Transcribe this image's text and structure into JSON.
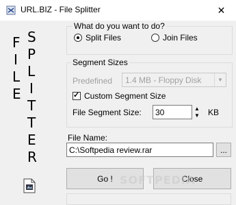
{
  "window": {
    "title": "URL.BIZ - File Splitter",
    "close_glyph": "✕"
  },
  "banner": {
    "word1": [
      "F",
      "I",
      "L",
      "E"
    ],
    "word2": [
      "S",
      "P",
      "L",
      "I",
      "T",
      "T",
      "E",
      "R"
    ]
  },
  "mode_group": {
    "title": "What do you want to do?",
    "options": [
      {
        "label": "Split Files",
        "selected": true
      },
      {
        "label": "Join Files",
        "selected": false
      }
    ]
  },
  "segment_group": {
    "title": "Segment Sizes",
    "predefined_label": "Predefined",
    "predefined_value": "1.4 MB - Floppy Disk",
    "custom_label": "Custom Segment Size",
    "custom_checked": true,
    "size_label": "File Segment Size:",
    "size_value": "30",
    "unit": "KB"
  },
  "file": {
    "label": "File Name:",
    "value": "C:\\Softpedia review.rar",
    "browse_label": "..."
  },
  "buttons": {
    "go": "Go !",
    "close": "Close"
  },
  "watermark": "SOFTPEDIA",
  "icons": {
    "app": "app-icon",
    "file": "file-document-icon"
  }
}
